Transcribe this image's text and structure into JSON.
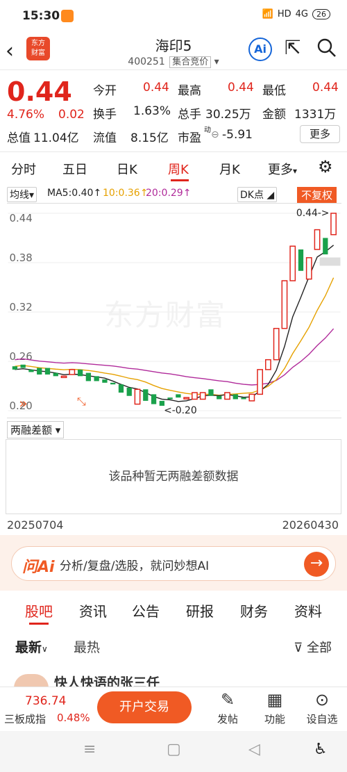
{
  "status_bar": {
    "time": "15:30",
    "network": "HD",
    "signal": "4G",
    "battery": "26"
  },
  "header": {
    "logo_line1": "东方",
    "logo_line2": "财富",
    "stock_name": "海印5",
    "stock_code": "400251",
    "auction_tag": "集合竞价"
  },
  "quote": {
    "price": "0.44",
    "change_pct": "4.76%",
    "change_val": "0.02",
    "open_label": "今开",
    "open_val": "0.44",
    "high_label": "最高",
    "high_val": "0.44",
    "low_label": "最低",
    "low_val": "0.44",
    "turnover_label": "换手",
    "turnover_val": "1.63%",
    "volume_label": "总手",
    "volume_val": "30.25万",
    "amount_label": "金额",
    "amount_val": "1331万",
    "mcap_label": "总值",
    "mcap_val": "11.04亿",
    "float_label": "流值",
    "float_val": "8.15亿",
    "pe_label": "市盈",
    "pe_sup": "动",
    "pe_val": "-5.91",
    "more_label": "更多"
  },
  "period_tabs": [
    "分时",
    "五日",
    "日K",
    "周K",
    "月K",
    "更多"
  ],
  "chart_toolbar": {
    "indicator": "均线",
    "ma5": "MA5:0.40↑",
    "ma10": "10:0.36↑",
    "ma20": "20:0.29↑",
    "dk": "DK点",
    "fq": "不复权"
  },
  "chart_data": {
    "type": "candlestick",
    "y_ticks": [
      "0.44",
      "0.38",
      "0.32",
      "0.26",
      "0.20"
    ],
    "ylim": [
      0.2,
      0.44
    ],
    "max_label": "0.44->",
    "min_label": "<-0.20",
    "watermark": "东方财富",
    "candles": [
      {
        "o": 0.254,
        "c": 0.25
      },
      {
        "o": 0.256,
        "c": 0.252
      },
      {
        "o": 0.25,
        "c": 0.247
      },
      {
        "o": 0.252,
        "c": 0.244
      },
      {
        "o": 0.252,
        "c": 0.244
      },
      {
        "o": 0.246,
        "c": 0.242
      },
      {
        "o": 0.242,
        "c": 0.242
      },
      {
        "o": 0.244,
        "c": 0.25
      },
      {
        "o": 0.25,
        "c": 0.242
      },
      {
        "o": 0.246,
        "c": 0.236
      },
      {
        "o": 0.242,
        "c": 0.236
      },
      {
        "o": 0.238,
        "c": 0.234
      },
      {
        "o": 0.234,
        "c": 0.232
      },
      {
        "o": 0.232,
        "c": 0.222
      },
      {
        "o": 0.228,
        "c": 0.218
      },
      {
        "o": 0.208,
        "c": 0.226
      },
      {
        "o": 0.226,
        "c": 0.212
      },
      {
        "o": 0.22,
        "c": 0.208
      },
      {
        "o": 0.212,
        "c": 0.206
      },
      {
        "o": 0.216,
        "c": 0.214
      },
      {
        "o": 0.22,
        "c": 0.216
      },
      {
        "o": 0.216,
        "c": 0.216
      },
      {
        "o": 0.214,
        "c": 0.222
      },
      {
        "o": 0.214,
        "c": 0.222
      },
      {
        "o": 0.226,
        "c": 0.218
      },
      {
        "o": 0.218,
        "c": 0.214
      },
      {
        "o": 0.214,
        "c": 0.222
      },
      {
        "o": 0.22,
        "c": 0.214
      },
      {
        "o": 0.216,
        "c": 0.214
      },
      {
        "o": 0.212,
        "c": 0.22
      },
      {
        "o": 0.22,
        "c": 0.25
      },
      {
        "o": 0.25,
        "c": 0.262
      },
      {
        "o": 0.262,
        "c": 0.3
      },
      {
        "o": 0.3,
        "c": 0.358
      },
      {
        "o": 0.358,
        "c": 0.4
      },
      {
        "o": 0.396,
        "c": 0.37
      },
      {
        "o": 0.36,
        "c": 0.386
      },
      {
        "o": 0.396,
        "c": 0.42
      },
      {
        "o": 0.41,
        "c": 0.39
      },
      {
        "o": 0.414,
        "c": 0.44
      }
    ]
  },
  "margin": {
    "selector": "两融差额",
    "empty_text": "该品种暂无两融差额数据",
    "date_start": "20250704",
    "date_end": "20260430"
  },
  "ai_bar": {
    "logo": "问Ai",
    "prompt": "分析/复盘/选股，就问妙想AI",
    "go": "→"
  },
  "content_tabs": [
    "股吧",
    "资讯",
    "公告",
    "研报",
    "财务",
    "资料"
  ],
  "sort": {
    "newest": "最新",
    "hottest": "最热",
    "filter": "全部"
  },
  "post_peek": "快人快语的张三任",
  "bottom_bar": {
    "index_value": "736.74",
    "index_name": "三板成指",
    "index_pct": "0.48%",
    "trade": "开户交易",
    "post": "发帖",
    "func": "功能",
    "custom": "设自选"
  }
}
